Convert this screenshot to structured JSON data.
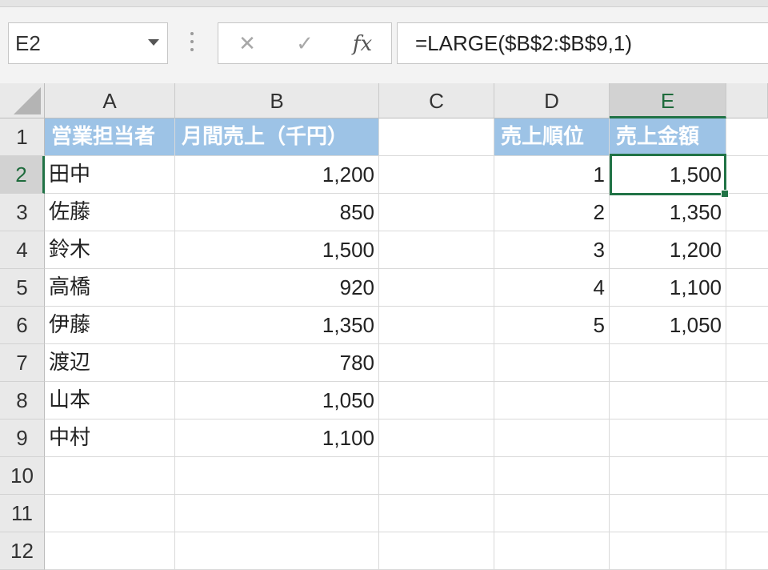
{
  "name_box": {
    "value": "E2"
  },
  "formula_bar": {
    "cancel_glyph": "✕",
    "confirm_glyph": "✓",
    "fx_label": "fx",
    "formula": "=LARGE($B$2:$B$9,1)"
  },
  "columns": [
    "A",
    "B",
    "C",
    "D",
    "E"
  ],
  "rows": [
    "1",
    "2",
    "3",
    "4",
    "5",
    "6",
    "7",
    "8",
    "9",
    "10",
    "11",
    "12"
  ],
  "selected": {
    "column": "E",
    "row": "2"
  },
  "colors": {
    "header_fill": "#9dc3e6",
    "selection": "#217346"
  },
  "sheet": {
    "A1": "営業担当者",
    "B1": "月間売上（千円）",
    "D1": "売上順位",
    "E1": "売上金額",
    "A2": "田中",
    "B2": "1,200",
    "D2": "1",
    "E2": "1,500",
    "A3": "佐藤",
    "B3": "850",
    "D3": "2",
    "E3": "1,350",
    "A4": "鈴木",
    "B4": "1,500",
    "D4": "3",
    "E4": "1,200",
    "A5": "高橋",
    "B5": "920",
    "D5": "4",
    "E5": "1,100",
    "A6": "伊藤",
    "B6": "1,350",
    "D6": "5",
    "E6": "1,050",
    "A7": "渡辺",
    "B7": "780",
    "A8": "山本",
    "B8": "1,050",
    "A9": "中村",
    "B9": "1,100"
  }
}
